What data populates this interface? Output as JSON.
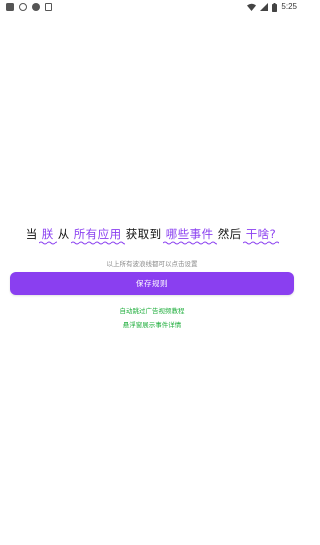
{
  "status_bar": {
    "time": "5:25",
    "left_icons": [
      "app-square-icon",
      "sync-ring-icon",
      "circle-dot-icon",
      "a-box-icon"
    ],
    "right_icons": [
      "wifi-icon",
      "signal-icon",
      "battery-icon"
    ]
  },
  "rule": {
    "word_1": "当",
    "pick_subject": "朕",
    "word_2": "从",
    "pick_apps": "所有应用",
    "word_3": "获取到",
    "pick_events": "哪些事件",
    "word_4": "然后",
    "pick_action": "干啥?"
  },
  "hint": "以上所有波浪线都可以点击设置",
  "save_button": "保存规则",
  "links": {
    "tutorial": "自动跳过广告视频教程",
    "floating": "悬浮窗展示事件详情"
  },
  "colors": {
    "accent": "#8a3ff0",
    "link": "#1fae3c",
    "hint": "#8a8a8a"
  }
}
